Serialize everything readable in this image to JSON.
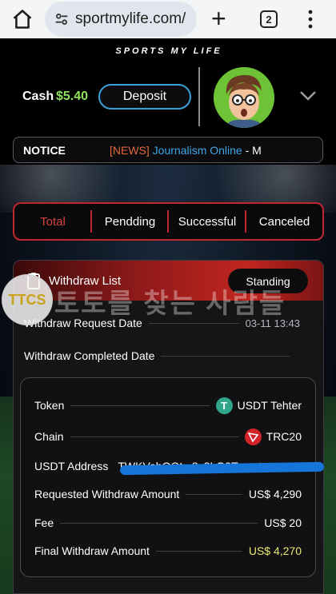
{
  "browser": {
    "url": "sportmylife.com/",
    "tab_count": "2"
  },
  "header": {
    "brand": "SPORTS MY LIFE",
    "cash_label": "Cash",
    "cash_value": "$5.40",
    "deposit_label": "Deposit"
  },
  "notice": {
    "label": "NOTICE",
    "tag": "[NEWS]",
    "link": "Journalism Online",
    "rest": " - M"
  },
  "filter": {
    "tabs": [
      {
        "label": "Total",
        "active": true
      },
      {
        "label": "Pendding",
        "active": false
      },
      {
        "label": "Successful",
        "active": false
      },
      {
        "label": "Canceled",
        "active": false
      }
    ]
  },
  "withdraw": {
    "title": "Withdraw List",
    "status": "Standing",
    "request_date_label": "Withdraw Request Date",
    "request_date": "03-11 13:43",
    "completed_date_label": "Withdraw Completed Date",
    "completed_date": "",
    "token_label": "Token",
    "token": "USDT Tehter",
    "chain_label": "Chain",
    "chain": "TRC20",
    "address_label": "USDT Address",
    "address": "TWKVebQQt...8c3LG2Txxmt...",
    "requested_label": "Requested Withdraw Amount",
    "requested": "US$ 4,290",
    "fee_label": "Fee",
    "fee": "US$ 20",
    "final_label": "Final Withdraw Amount",
    "final": "US$ 4,270"
  },
  "watermark": {
    "logo": "TTCS",
    "text": "토토를 찾는 사람들"
  },
  "colors": {
    "accent_red": "#c1272d",
    "cash_green": "#8ee35a",
    "link_blue": "#3ea6e6",
    "final_yellow": "#e9e872",
    "tether_green": "#2fa68a"
  }
}
